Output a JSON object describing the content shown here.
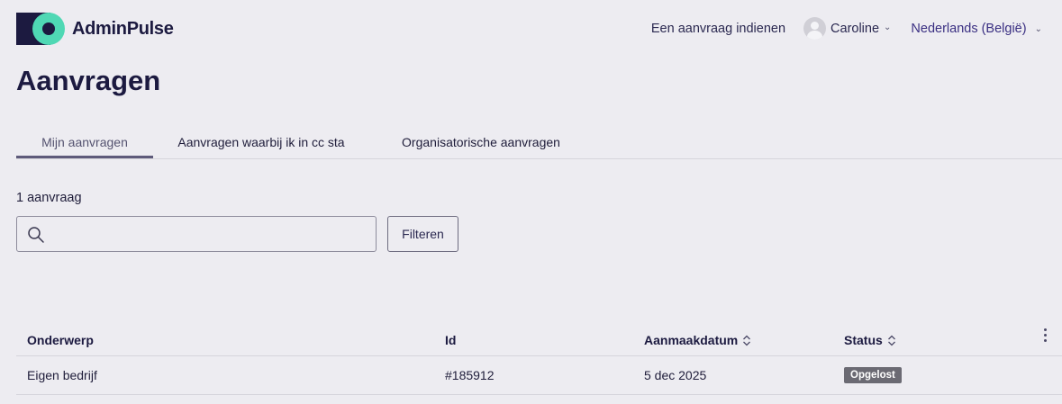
{
  "brand": {
    "name": "AdminPulse"
  },
  "topnav": {
    "submit_request": "Een aanvraag indienen",
    "user_name": "Caroline",
    "language": "Nederlands (België)"
  },
  "page": {
    "title": "Aanvragen"
  },
  "tabs": [
    {
      "label": "Mijn aanvragen",
      "active": true
    },
    {
      "label": "Aanvragen waarbij ik in cc sta",
      "active": false
    },
    {
      "label": "Organisatorische aanvragen",
      "active": false
    }
  ],
  "results": {
    "count_text": "1 aanvraag"
  },
  "search": {
    "value": "",
    "placeholder": ""
  },
  "filter": {
    "label": "Filteren"
  },
  "table": {
    "columns": [
      "Onderwerp",
      "Id",
      "Aanmaakdatum",
      "Status"
    ],
    "rows": [
      {
        "subject": "Eigen bedrijf",
        "id": "#185912",
        "created": "5 dec 2025",
        "status": "Opgelost"
      }
    ]
  },
  "colors": {
    "background": "#edecf1",
    "brand_dark": "#1c1a40",
    "brand_accent": "#4fd8b4",
    "status_badge": "#6b6a73"
  },
  "icons": {
    "user": "avatar-icon",
    "search": "search-icon",
    "sort": "sort-icon",
    "more": "kebab-menu-icon"
  }
}
